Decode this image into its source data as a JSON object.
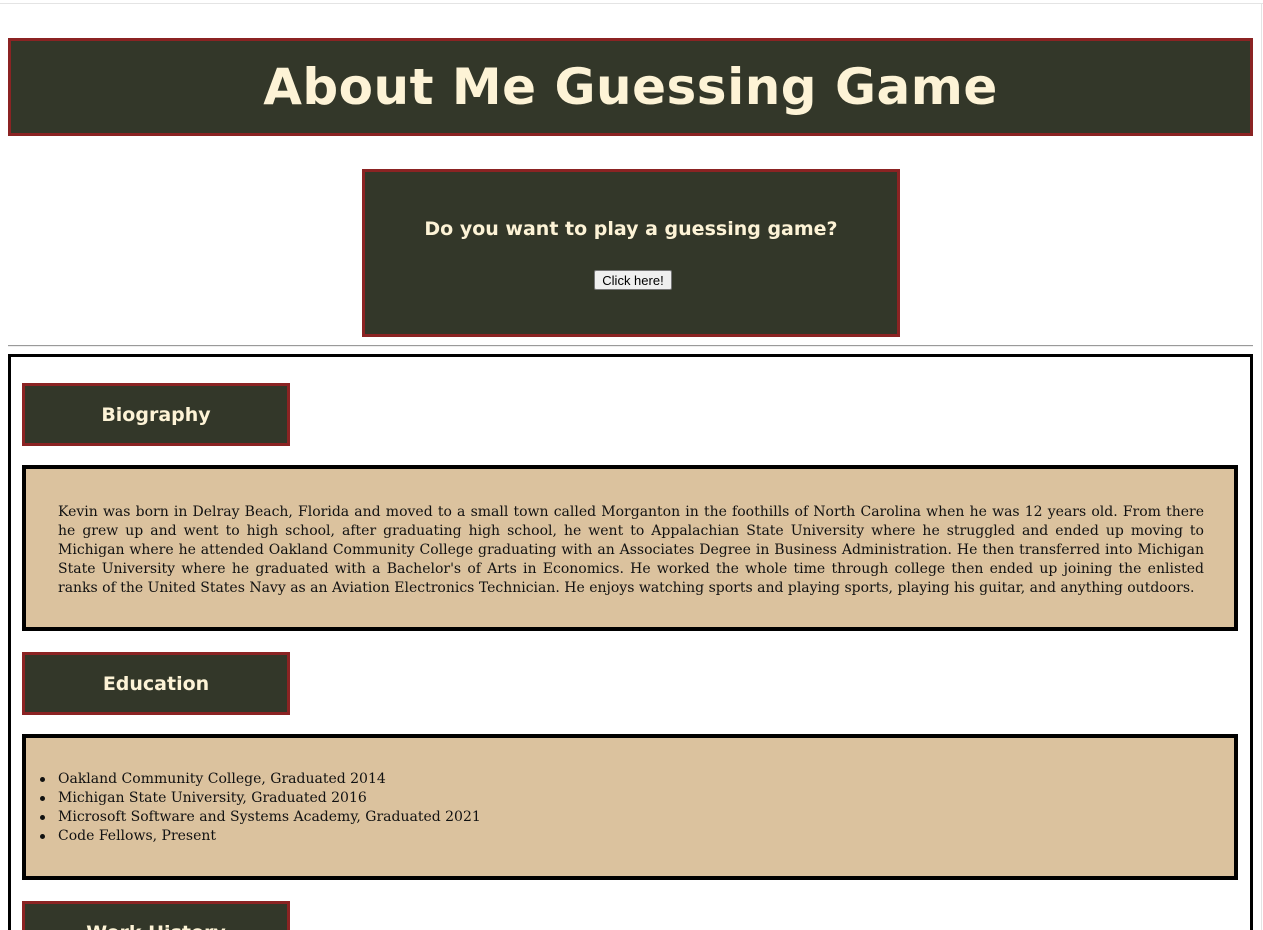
{
  "header": {
    "title": "About Me Guessing Game"
  },
  "game": {
    "question": "Do you want to play a guessing game?",
    "button_label": "Click here!"
  },
  "sections": {
    "biography": {
      "label": "Biography",
      "text": "Kevin was born in Delray Beach, Florida and moved to a small town called Morganton in the foothills of North Carolina when he was 12 years old. From there he grew up and went to high school, after graduating high school, he went to Appalachian State University where he struggled and ended up moving to Michigan where he attended Oakland Community College graduating with an Associates Degree in Business Administration. He then transferred into Michigan State University where he graduated with a Bachelor's of Arts in Economics. He worked the whole time through college then ended up joining the enlisted ranks of the United States Navy as an Aviation Electronics Technician. He enjoys watching sports and playing sports, playing his guitar, and anything outdoors."
    },
    "education": {
      "label": "Education",
      "items": [
        "Oakland Community College, Graduated 2014",
        "Michigan State University, Graduated 2016",
        "Microsoft Software and Systems Academy, Graduated 2021",
        "Code Fellows, Present"
      ]
    },
    "work_history": {
      "label": "Work History"
    }
  },
  "colors": {
    "panel_bg": "#333729",
    "panel_border": "#8b2323",
    "panel_text": "#fdf3d6",
    "content_bg": "#dbc29e"
  }
}
